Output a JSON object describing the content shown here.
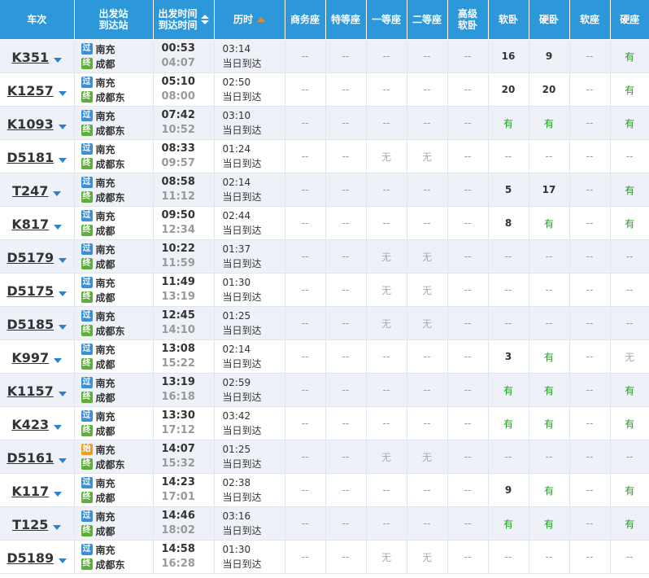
{
  "header": {
    "train": "车次",
    "station_from": "出发站",
    "station_to": "到达站",
    "time_dep": "出发时间",
    "time_arr": "到达时间",
    "duration": "历时",
    "seats": [
      "商务座",
      "特等座",
      "一等座",
      "二等座",
      "高级\n软卧",
      "软卧",
      "硬卧",
      "软座",
      "硬座"
    ]
  },
  "icons": {
    "pass": "过",
    "start": "始",
    "end": "终"
  },
  "colors": {
    "header_bg": "#2d98d9",
    "row_alt": "#eef1f8",
    "available": "#1f9d1f",
    "sort_active": "#f08a1c"
  },
  "trains": [
    {
      "no": "K351",
      "from": "南充",
      "from_type": "pass",
      "to": "成都",
      "dep": "00:53",
      "arr": "04:07",
      "dur": "03:14",
      "day": "当日到达",
      "seats": [
        "--",
        "--",
        "--",
        "--",
        "--",
        "16",
        "9",
        "--",
        "有"
      ]
    },
    {
      "no": "K1257",
      "from": "南充",
      "from_type": "pass",
      "to": "成都东",
      "dep": "05:10",
      "arr": "08:00",
      "dur": "02:50",
      "day": "当日到达",
      "seats": [
        "--",
        "--",
        "--",
        "--",
        "--",
        "20",
        "20",
        "--",
        "有"
      ]
    },
    {
      "no": "K1093",
      "from": "南充",
      "from_type": "pass",
      "to": "成都东",
      "dep": "07:42",
      "arr": "10:52",
      "dur": "03:10",
      "day": "当日到达",
      "seats": [
        "--",
        "--",
        "--",
        "--",
        "--",
        "有",
        "有",
        "--",
        "有"
      ]
    },
    {
      "no": "D5181",
      "from": "南充",
      "from_type": "pass",
      "to": "成都东",
      "dep": "08:33",
      "arr": "09:57",
      "dur": "01:24",
      "day": "当日到达",
      "seats": [
        "--",
        "--",
        "无",
        "无",
        "--",
        "--",
        "--",
        "--",
        "--"
      ]
    },
    {
      "no": "T247",
      "from": "南充",
      "from_type": "pass",
      "to": "成都东",
      "dep": "08:58",
      "arr": "11:12",
      "dur": "02:14",
      "day": "当日到达",
      "seats": [
        "--",
        "--",
        "--",
        "--",
        "--",
        "5",
        "17",
        "--",
        "有"
      ]
    },
    {
      "no": "K817",
      "from": "南充",
      "from_type": "pass",
      "to": "成都",
      "dep": "09:50",
      "arr": "12:34",
      "dur": "02:44",
      "day": "当日到达",
      "seats": [
        "--",
        "--",
        "--",
        "--",
        "--",
        "8",
        "有",
        "--",
        "有"
      ]
    },
    {
      "no": "D5179",
      "from": "南充",
      "from_type": "pass",
      "to": "成都",
      "dep": "10:22",
      "arr": "11:59",
      "dur": "01:37",
      "day": "当日到达",
      "seats": [
        "--",
        "--",
        "无",
        "无",
        "--",
        "--",
        "--",
        "--",
        "--"
      ]
    },
    {
      "no": "D5175",
      "from": "南充",
      "from_type": "pass",
      "to": "成都",
      "dep": "11:49",
      "arr": "13:19",
      "dur": "01:30",
      "day": "当日到达",
      "seats": [
        "--",
        "--",
        "无",
        "无",
        "--",
        "--",
        "--",
        "--",
        "--"
      ]
    },
    {
      "no": "D5185",
      "from": "南充",
      "from_type": "pass",
      "to": "成都东",
      "dep": "12:45",
      "arr": "14:10",
      "dur": "01:25",
      "day": "当日到达",
      "seats": [
        "--",
        "--",
        "无",
        "无",
        "--",
        "--",
        "--",
        "--",
        "--"
      ]
    },
    {
      "no": "K997",
      "from": "南充",
      "from_type": "pass",
      "to": "成都",
      "dep": "13:08",
      "arr": "15:22",
      "dur": "02:14",
      "day": "当日到达",
      "seats": [
        "--",
        "--",
        "--",
        "--",
        "--",
        "3",
        "有",
        "--",
        "无"
      ]
    },
    {
      "no": "K1157",
      "from": "南充",
      "from_type": "pass",
      "to": "成都",
      "dep": "13:19",
      "arr": "16:18",
      "dur": "02:59",
      "day": "当日到达",
      "seats": [
        "--",
        "--",
        "--",
        "--",
        "--",
        "有",
        "有",
        "--",
        "有"
      ]
    },
    {
      "no": "K423",
      "from": "南充",
      "from_type": "pass",
      "to": "成都",
      "dep": "13:30",
      "arr": "17:12",
      "dur": "03:42",
      "day": "当日到达",
      "seats": [
        "--",
        "--",
        "--",
        "--",
        "--",
        "有",
        "有",
        "--",
        "有"
      ]
    },
    {
      "no": "D5161",
      "from": "南充",
      "from_type": "start",
      "to": "成都东",
      "dep": "14:07",
      "arr": "15:32",
      "dur": "01:25",
      "day": "当日到达",
      "seats": [
        "--",
        "--",
        "无",
        "无",
        "--",
        "--",
        "--",
        "--",
        "--"
      ]
    },
    {
      "no": "K117",
      "from": "南充",
      "from_type": "pass",
      "to": "成都",
      "dep": "14:23",
      "arr": "17:01",
      "dur": "02:38",
      "day": "当日到达",
      "seats": [
        "--",
        "--",
        "--",
        "--",
        "--",
        "9",
        "有",
        "--",
        "有"
      ]
    },
    {
      "no": "T125",
      "from": "南充",
      "from_type": "pass",
      "to": "成都",
      "dep": "14:46",
      "arr": "18:02",
      "dur": "03:16",
      "day": "当日到达",
      "seats": [
        "--",
        "--",
        "--",
        "--",
        "--",
        "有",
        "有",
        "--",
        "有"
      ]
    },
    {
      "no": "D5189",
      "from": "南充",
      "from_type": "pass",
      "to": "成都东",
      "dep": "14:58",
      "arr": "16:28",
      "dur": "01:30",
      "day": "当日到达",
      "seats": [
        "--",
        "--",
        "无",
        "无",
        "--",
        "--",
        "--",
        "--",
        "--"
      ]
    }
  ]
}
